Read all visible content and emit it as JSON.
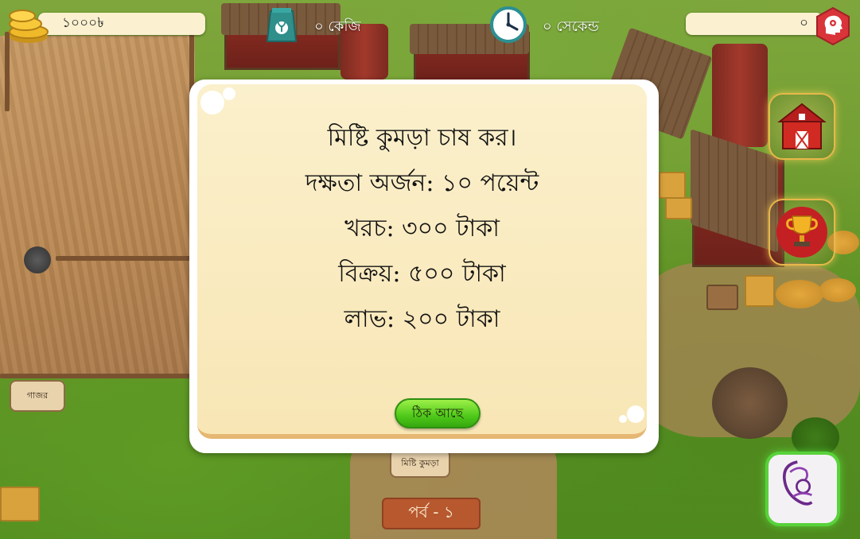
{
  "hud": {
    "coins": "১০০০৳",
    "seed_amount": "০ কেজি",
    "timer": "০ সেকেন্ড",
    "xp": "০"
  },
  "dialog": {
    "lines": [
      "মিষ্টি কুমড়া চাষ কর।",
      "দক্ষতা অর্জন: ১০ পয়েন্ট",
      "খরচ: ৩০০ টাকা",
      "বিক্রয়: ৫০০ টাকা",
      "লাভ: ২০০ টাকা"
    ],
    "ok_label": "ঠিক আছে"
  },
  "signs": {
    "carrot": "গাজর",
    "pumpkin": "মিষ্টি কুমড়া"
  },
  "level": "পর্ব - ১",
  "colors": {
    "hud_pill": "#fbf0cf",
    "dialog_bg": "#f8e6b5",
    "ok_button": "#4fc81a",
    "settings_red": "#d8343a",
    "level_badge": "#b9562e"
  },
  "icons": {
    "coins": "gold-coins-icon",
    "seed": "seed-bag-icon",
    "clock": "clock-icon",
    "settings": "gear-head-icon",
    "barn": "barn-icon",
    "trophy": "trophy-icon",
    "logo": "mother-child-logo-icon"
  }
}
